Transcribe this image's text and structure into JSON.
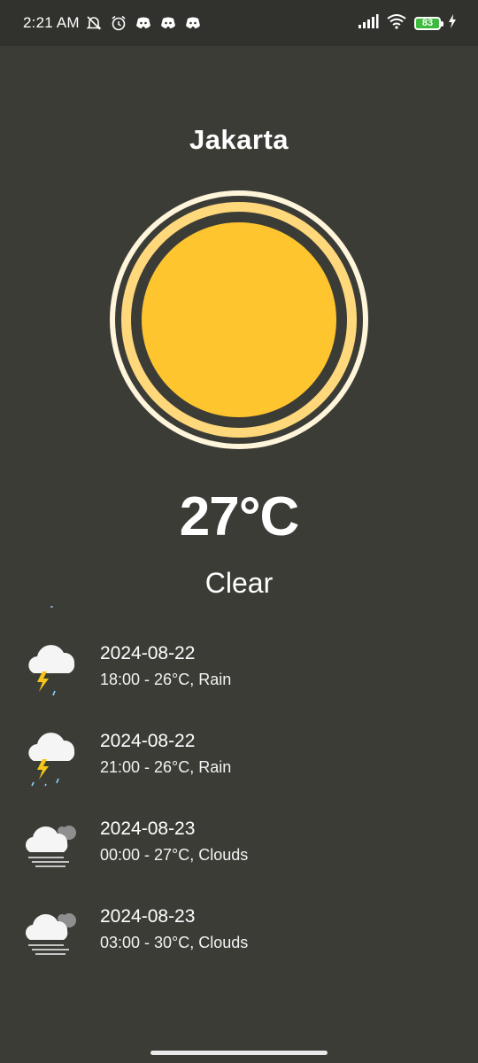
{
  "status": {
    "time": "2:21 AM",
    "battery": "83"
  },
  "weather": {
    "city": "Jakarta",
    "temperature": "27°C",
    "condition": "Clear",
    "sun_icon": "sun-icon"
  },
  "forecast": [
    {
      "date": "2024-08-22",
      "detail": "18:00 - 26°C, Rain",
      "icon": "thunderstorm-icon"
    },
    {
      "date": "2024-08-22",
      "detail": "21:00 - 26°C, Rain",
      "icon": "thunderstorm-icon"
    },
    {
      "date": "2024-08-23",
      "detail": "00:00 - 27°C, Clouds",
      "icon": "cloudy-fog-icon"
    },
    {
      "date": "2024-08-23",
      "detail": "03:00 - 30°C, Clouds",
      "icon": "cloudy-fog-icon"
    }
  ],
  "colors": {
    "background": "#3c3c37",
    "status_bar": "#31312d",
    "sun_core": "#fec52f",
    "sun_ring": "#fed87a",
    "sun_outer": "#fff5da",
    "battery": "#3dbb3d"
  }
}
